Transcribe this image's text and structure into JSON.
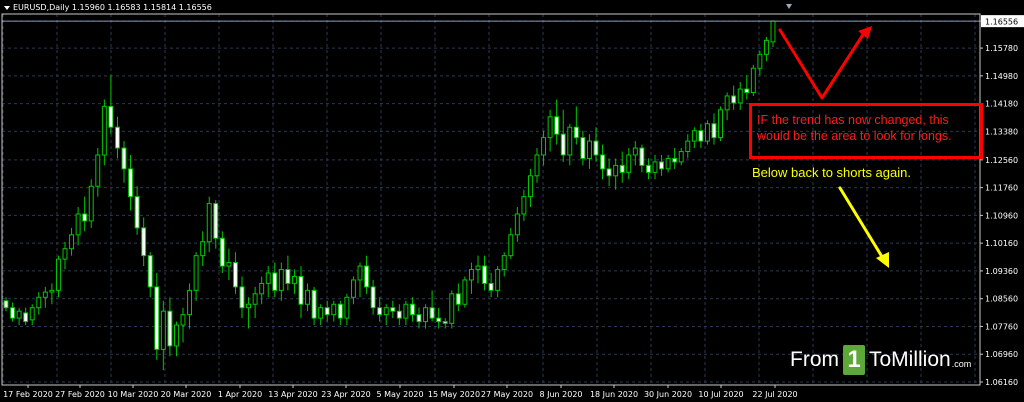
{
  "header": {
    "symbol_text": "EURUSD,Daily  1.15960 1.16583 1.15814 1.16556"
  },
  "annotations": {
    "box_text": "IF the trend has now changed, this would be the area to look for longs.",
    "yellow_text": "Below back to shorts again."
  },
  "logo": {
    "part1": "From",
    "one": "1",
    "part2": "ToMillion",
    "domain": ".com"
  },
  "colors": {
    "background": "#000000",
    "grid": "#2a3a52",
    "candle": "#00c800",
    "bull_body": "#000000",
    "bear_body": "#ffffff",
    "price_label_bg": "#ffffff",
    "annotation_red": "#ff0000",
    "annotation_yellow": "#ffff00",
    "logo_green": "#5ea83a"
  },
  "chart_data": {
    "type": "candlestick",
    "symbol": "EURUSD",
    "timeframe": "Daily",
    "current_price": "1.16556",
    "ylim": [
      1.0616,
      1.1656
    ],
    "y_ticks": [
      "1.16556",
      "1.15780",
      "1.14980",
      "1.14180",
      "1.13380",
      "1.12560",
      "1.11760",
      "1.10960",
      "1.10160",
      "1.09360",
      "1.08560",
      "1.07760",
      "1.06960",
      "1.06160"
    ],
    "x_ticks": [
      "17 Feb 2020",
      "27 Feb 2020",
      "10 Mar 2020",
      "20 Mar 2020",
      "1 Apr 2020",
      "13 Apr 2020",
      "23 Apr 2020",
      "5 May 2020",
      "15 May 2020",
      "27 May 2020",
      "8 Jun 2020",
      "18 Jun 2020",
      "30 Jun 2020",
      "10 Jul 2020",
      "22 Jul 2020"
    ],
    "series": [
      {
        "ohlc": [
          [
            1.085,
            1.086,
            1.082,
            1.083
          ],
          [
            1.083,
            1.0845,
            1.079,
            1.08
          ],
          [
            1.08,
            1.083,
            1.078,
            1.082
          ],
          [
            1.0815,
            1.083,
            1.078,
            1.079
          ],
          [
            1.0795,
            1.084,
            1.078,
            1.083
          ],
          [
            1.083,
            1.0875,
            1.081,
            1.086
          ],
          [
            1.086,
            1.089,
            1.083,
            1.0875
          ],
          [
            1.0875,
            1.09,
            1.084,
            1.088
          ],
          [
            1.088,
            1.098,
            1.086,
            1.097
          ],
          [
            1.097,
            1.102,
            1.094,
            1.1
          ],
          [
            1.1,
            1.106,
            1.098,
            1.104
          ],
          [
            1.104,
            1.112,
            1.101,
            1.11
          ],
          [
            1.11,
            1.115,
            1.105,
            1.108
          ],
          [
            1.108,
            1.12,
            1.106,
            1.118
          ],
          [
            1.118,
            1.129,
            1.115,
            1.127
          ],
          [
            1.127,
            1.143,
            1.124,
            1.141
          ],
          [
            1.141,
            1.15,
            1.133,
            1.135
          ],
          [
            1.135,
            1.138,
            1.126,
            1.129
          ],
          [
            1.129,
            1.131,
            1.119,
            1.123
          ],
          [
            1.123,
            1.127,
            1.111,
            1.115
          ],
          [
            1.115,
            1.118,
            1.104,
            1.106
          ],
          [
            1.106,
            1.109,
            1.095,
            1.098
          ],
          [
            1.098,
            1.099,
            1.086,
            1.089
          ],
          [
            1.089,
            1.093,
            1.068,
            1.071
          ],
          [
            1.071,
            1.085,
            1.065,
            1.082
          ],
          [
            1.082,
            1.086,
            1.069,
            1.072
          ],
          [
            1.072,
            1.079,
            1.069,
            1.078
          ],
          [
            1.078,
            1.083,
            1.073,
            1.081
          ],
          [
            1.081,
            1.09,
            1.077,
            1.088
          ],
          [
            1.088,
            1.099,
            1.085,
            1.098
          ],
          [
            1.098,
            1.105,
            1.095,
            1.102
          ],
          [
            1.102,
            1.115,
            1.099,
            1.113
          ],
          [
            1.113,
            1.114,
            1.1,
            1.103
          ],
          [
            1.103,
            1.105,
            1.093,
            1.095
          ],
          [
            1.095,
            1.1,
            1.091,
            1.096
          ],
          [
            1.096,
            1.099,
            1.087,
            1.089
          ],
          [
            1.089,
            1.092,
            1.08,
            1.083
          ],
          [
            1.083,
            1.086,
            1.077,
            1.084
          ],
          [
            1.084,
            1.089,
            1.08,
            1.087
          ],
          [
            1.087,
            1.092,
            1.084,
            1.09
          ],
          [
            1.09,
            1.095,
            1.086,
            1.093
          ],
          [
            1.093,
            1.096,
            1.086,
            1.088
          ],
          [
            1.088,
            1.096,
            1.085,
            1.094
          ],
          [
            1.094,
            1.098,
            1.088,
            1.09
          ],
          [
            1.09,
            1.094,
            1.087,
            1.092
          ],
          [
            1.092,
            1.095,
            1.08,
            1.084
          ],
          [
            1.084,
            1.09,
            1.082,
            1.088
          ],
          [
            1.088,
            1.089,
            1.078,
            1.08
          ],
          [
            1.08,
            1.084,
            1.078,
            1.083
          ],
          [
            1.083,
            1.085,
            1.079,
            1.081
          ],
          [
            1.081,
            1.085,
            1.079,
            1.084
          ],
          [
            1.084,
            1.085,
            1.078,
            1.08
          ],
          [
            1.08,
            1.087,
            1.078,
            1.086
          ],
          [
            1.086,
            1.092,
            1.084,
            1.091
          ],
          [
            1.091,
            1.096,
            1.086,
            1.095
          ],
          [
            1.095,
            1.098,
            1.087,
            1.089
          ],
          [
            1.089,
            1.091,
            1.081,
            1.083
          ],
          [
            1.083,
            1.086,
            1.079,
            1.081
          ],
          [
            1.081,
            1.084,
            1.078,
            1.083
          ],
          [
            1.083,
            1.085,
            1.08,
            1.082
          ],
          [
            1.082,
            1.084,
            1.078,
            1.08
          ],
          [
            1.08,
            1.085,
            1.078,
            1.084
          ],
          [
            1.084,
            1.086,
            1.079,
            1.081
          ],
          [
            1.081,
            1.083,
            1.077,
            1.079
          ],
          [
            1.079,
            1.084,
            1.077,
            1.083
          ],
          [
            1.083,
            1.088,
            1.079,
            1.08
          ],
          [
            1.08,
            1.083,
            1.077,
            1.079
          ],
          [
            1.079,
            1.08,
            1.077,
            1.0785
          ],
          [
            1.0785,
            1.088,
            1.077,
            1.087
          ],
          [
            1.087,
            1.09,
            1.082,
            1.084
          ],
          [
            1.084,
            1.092,
            1.083,
            1.091
          ],
          [
            1.091,
            1.096,
            1.087,
            1.094
          ],
          [
            1.094,
            1.098,
            1.09,
            1.095
          ],
          [
            1.095,
            1.098,
            1.088,
            1.09
          ],
          [
            1.09,
            1.093,
            1.086,
            1.088
          ],
          [
            1.088,
            1.095,
            1.086,
            1.094
          ],
          [
            1.094,
            1.099,
            1.092,
            1.098
          ],
          [
            1.098,
            1.106,
            1.097,
            1.104
          ],
          [
            1.104,
            1.112,
            1.102,
            1.11
          ],
          [
            1.11,
            1.117,
            1.108,
            1.115
          ],
          [
            1.115,
            1.123,
            1.112,
            1.121
          ],
          [
            1.121,
            1.129,
            1.119,
            1.127
          ],
          [
            1.127,
            1.134,
            1.124,
            1.132
          ],
          [
            1.132,
            1.14,
            1.128,
            1.138
          ],
          [
            1.138,
            1.143,
            1.13,
            1.133
          ],
          [
            1.133,
            1.14,
            1.125,
            1.127
          ],
          [
            1.127,
            1.136,
            1.124,
            1.135
          ],
          [
            1.135,
            1.141,
            1.13,
            1.132
          ],
          [
            1.132,
            1.134,
            1.124,
            1.126
          ],
          [
            1.126,
            1.133,
            1.123,
            1.131
          ],
          [
            1.131,
            1.135,
            1.125,
            1.127
          ],
          [
            1.127,
            1.13,
            1.12,
            1.123
          ],
          [
            1.123,
            1.126,
            1.118,
            1.121
          ],
          [
            1.121,
            1.126,
            1.117,
            1.124
          ],
          [
            1.124,
            1.128,
            1.119,
            1.122
          ],
          [
            1.122,
            1.129,
            1.12,
            1.127
          ],
          [
            1.127,
            1.131,
            1.124,
            1.129
          ],
          [
            1.129,
            1.13,
            1.122,
            1.124
          ],
          [
            1.124,
            1.126,
            1.12,
            1.122
          ],
          [
            1.122,
            1.127,
            1.12,
            1.125
          ],
          [
            1.125,
            1.127,
            1.121,
            1.123
          ],
          [
            1.123,
            1.127,
            1.122,
            1.126
          ],
          [
            1.126,
            1.129,
            1.123,
            1.125
          ],
          [
            1.125,
            1.129,
            1.124,
            1.128
          ],
          [
            1.128,
            1.133,
            1.126,
            1.131
          ],
          [
            1.131,
            1.135,
            1.129,
            1.134
          ],
          [
            1.134,
            1.136,
            1.129,
            1.131
          ],
          [
            1.131,
            1.137,
            1.13,
            1.136
          ],
          [
            1.136,
            1.139,
            1.13,
            1.132
          ],
          [
            1.132,
            1.141,
            1.131,
            1.14
          ],
          [
            1.14,
            1.145,
            1.137,
            1.144
          ],
          [
            1.144,
            1.147,
            1.14,
            1.142
          ],
          [
            1.142,
            1.148,
            1.14,
            1.146
          ],
          [
            1.146,
            1.15,
            1.143,
            1.145
          ],
          [
            1.145,
            1.153,
            1.144,
            1.152
          ],
          [
            1.152,
            1.157,
            1.15,
            1.156
          ],
          [
            1.156,
            1.161,
            1.154,
            1.16
          ],
          [
            1.1596,
            1.1658,
            1.1581,
            1.1656
          ]
        ]
      }
    ]
  }
}
